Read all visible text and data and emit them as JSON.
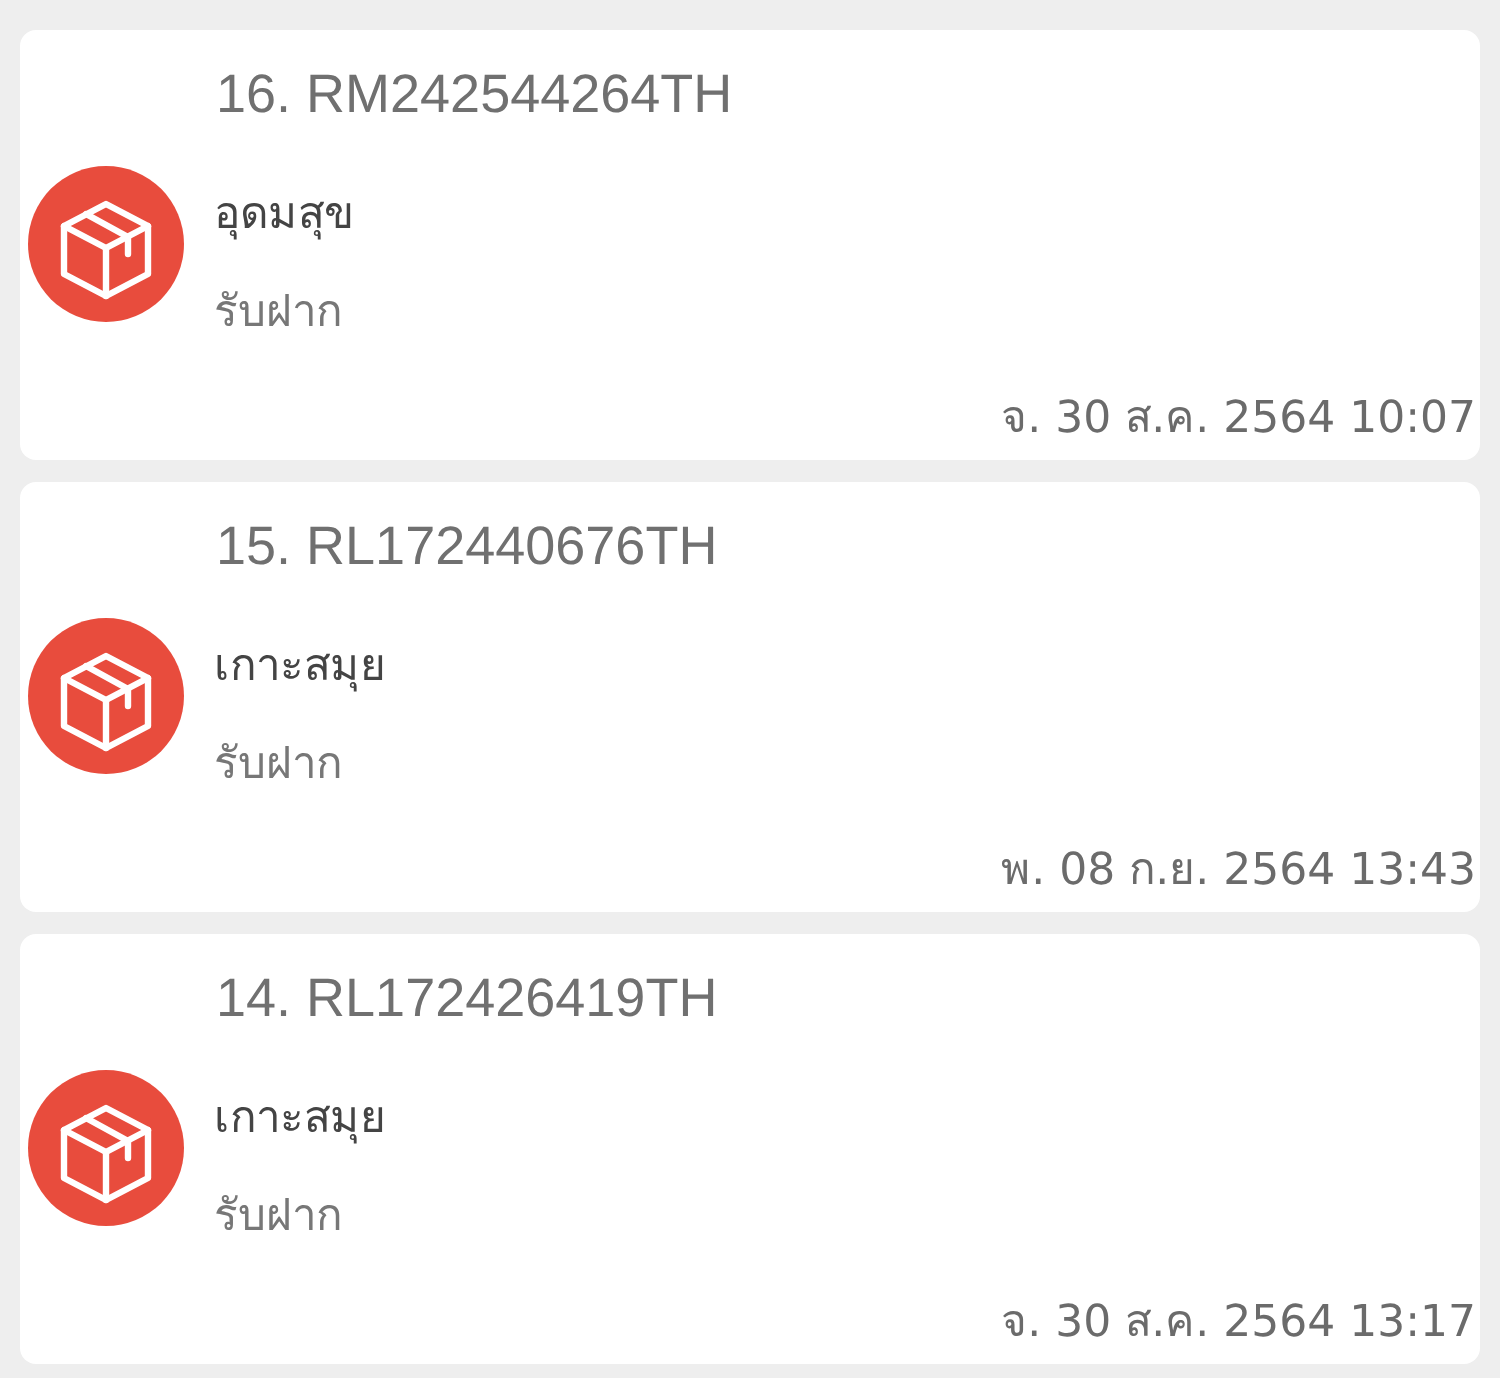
{
  "items": [
    {
      "title": "16. RM242544264TH",
      "location": "อุดมสุข",
      "status": "รับฝาก",
      "datetime": "จ. 30 ส.ค. 2564 10:07"
    },
    {
      "title": "15. RL172440676TH",
      "location": "เกาะสมุย",
      "status": "รับฝาก",
      "datetime": "พ. 08 ก.ย. 2564 13:43"
    },
    {
      "title": "14. RL172426419TH",
      "location": "เกาะสมุย",
      "status": "รับฝาก",
      "datetime": "จ. 30 ส.ค. 2564 13:17"
    }
  ]
}
